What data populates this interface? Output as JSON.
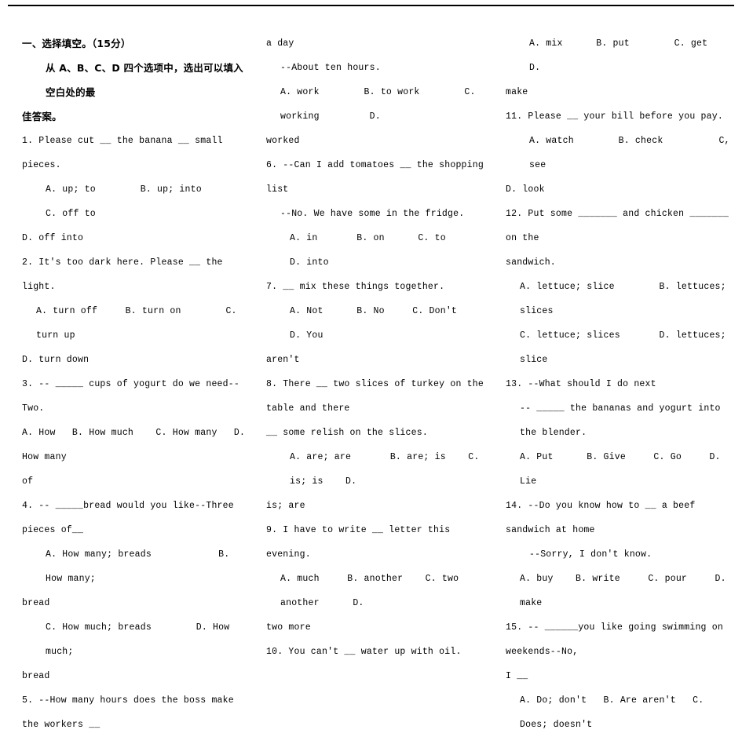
{
  "document": {
    "section_heading": "一、选择填空。（15分）",
    "instruction_line1": "从 A、B、C、D 四个选项中，选出可以填入空白处的最",
    "instruction_line2": "佳答案。"
  },
  "column1": [
    {
      "text": "1. Please cut __ the banana __ small pieces.",
      "indent": 0
    },
    {
      "text": "A. up; to        B. up; into        C. off to",
      "indent": 2
    },
    {
      "text": "D. off into",
      "indent": 0
    },
    {
      "text": "2. It's too dark here. Please __ the light.",
      "indent": 0
    },
    {
      "text": "A. turn off     B. turn on        C. turn up",
      "indent": 1
    },
    {
      "text": "D. turn down",
      "indent": 0
    },
    {
      "text": "3. -- _____ cups of yogurt do we need--Two.",
      "indent": 0
    },
    {
      "text": "A. How   B. How much    C. How many   D. How many",
      "indent": 0
    },
    {
      "text": "of",
      "indent": 0
    },
    {
      "text": "4. -- _____bread would you like--Three pieces of__",
      "indent": 0
    },
    {
      "text": "A. How many; breads            B. How many;",
      "indent": 2
    },
    {
      "text": "bread",
      "indent": 0
    },
    {
      "text": "C. How much; breads        D. How much;",
      "indent": 2
    },
    {
      "text": "bread",
      "indent": 0
    },
    {
      "text": "5. --How many hours does the boss make the workers __",
      "indent": 0
    }
  ],
  "column2": [
    {
      "text": "a day",
      "indent": 0
    },
    {
      "text": "--About ten hours.",
      "indent": 1
    },
    {
      "text": "A. work        B. to work        C. working         D.",
      "indent": 1
    },
    {
      "text": "worked",
      "indent": 0
    },
    {
      "text": "6. --Can I add tomatoes __ the shopping list",
      "indent": 0
    },
    {
      "text": "--No. We have some in the fridge.",
      "indent": 1
    },
    {
      "text": "A. in       B. on      C. to      D. into",
      "indent": 2
    },
    {
      "text": "7. __ mix these things together.",
      "indent": 0
    },
    {
      "text": "A. Not      B. No     C. Don't      D. You",
      "indent": 2
    },
    {
      "text": "aren't",
      "indent": 0
    },
    {
      "text": "8. There __ two slices of turkey on the table and there",
      "indent": 0
    },
    {
      "text": "__ some relish on the slices.",
      "indent": 0
    },
    {
      "text": "A. are; are       B. are; is    C. is; is    D.",
      "indent": 2
    },
    {
      "text": "is; are",
      "indent": 0
    },
    {
      "text": "9. I have to write __ letter this evening.",
      "indent": 0
    },
    {
      "text": "A. much     B. another    C. two another      D.",
      "indent": 1
    },
    {
      "text": "two more",
      "indent": 0
    },
    {
      "text": "10. You can't __ water up with oil.",
      "indent": 0
    }
  ],
  "column3": [
    {
      "text": "A. mix      B. put        C. get        D.",
      "indent": 2
    },
    {
      "text": "make",
      "indent": 0
    },
    {
      "text": "11. Please __ your bill before you pay.",
      "indent": 0
    },
    {
      "text": "A. watch        B. check          C, see",
      "indent": 2
    },
    {
      "text": "D. look",
      "indent": 0
    },
    {
      "text": "12. Put some _______ and chicken _______ on the",
      "indent": 0
    },
    {
      "text": "sandwich.",
      "indent": 0
    },
    {
      "text": "A. lettuce; slice        B. lettuces; slices",
      "indent": 1
    },
    {
      "text": "C. lettuce; slices       D. lettuces; slice",
      "indent": 1
    },
    {
      "text": "13. --What should I do next",
      "indent": 0
    },
    {
      "text": "-- _____ the bananas and yogurt into the blender.",
      "indent": 1
    },
    {
      "text": "A. Put      B. Give     C. Go     D. Lie",
      "indent": 1
    },
    {
      "text": "14. --Do you know how to __ a beef sandwich at home",
      "indent": 0
    },
    {
      "text": "--Sorry, I don't know.",
      "indent": 2
    },
    {
      "text": "A. buy    B. write     C. pour     D. make",
      "indent": 1
    },
    {
      "text": "15. -- ______you like going swimming on weekends--No,",
      "indent": 0
    },
    {
      "text": "I __",
      "indent": 0
    },
    {
      "text": "A. Do; don't   B. Are aren't   C. Does; doesn't",
      "indent": 1
    }
  ]
}
